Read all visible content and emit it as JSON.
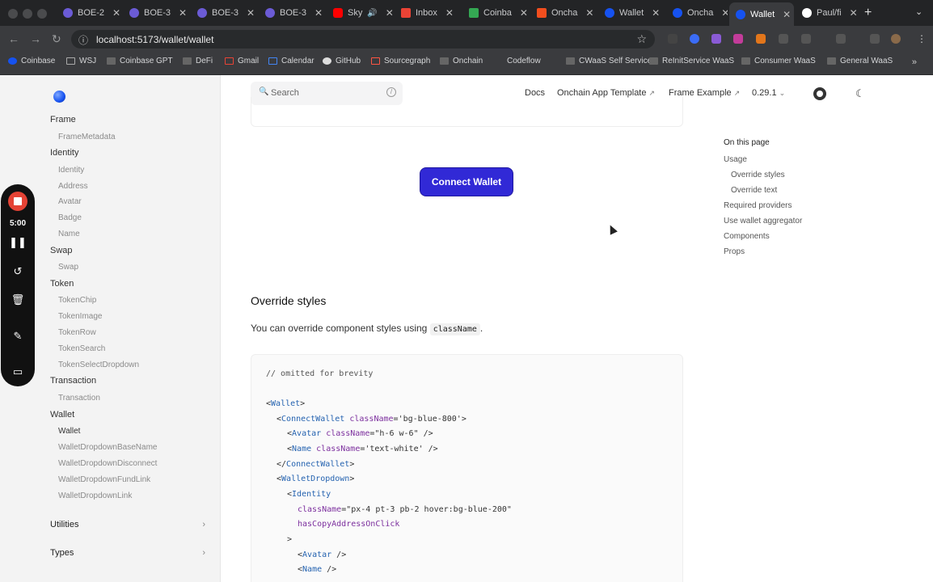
{
  "browser": {
    "tabs": [
      {
        "title": "BOE-2",
        "color": "#6b5bd6"
      },
      {
        "title": "BOE-3",
        "color": "#6b5bd6"
      },
      {
        "title": "BOE-3",
        "color": "#6b5bd6"
      },
      {
        "title": "BOE-3",
        "color": "#6b5bd6"
      },
      {
        "title": "Sky",
        "color": "#ff0000"
      },
      {
        "title": "Inbox",
        "color": "#ea4335"
      },
      {
        "title": "Coinba",
        "color": "#34a853"
      },
      {
        "title": "Oncha",
        "color": "#f24e1e"
      },
      {
        "title": "Wallet",
        "color": "#1652f0"
      },
      {
        "title": "Oncha",
        "color": "#1652f0"
      },
      {
        "title": "Wallet",
        "color": "#1652f0"
      },
      {
        "title": "Paul/fi",
        "color": "#ffffff"
      }
    ],
    "url": "localhost:5173/wallet/wallet",
    "bookmarks": [
      "Coinbase",
      "WSJ",
      "Coinbase GPT",
      "DeFi",
      "Gmail",
      "Calendar",
      "GitHub",
      "Sourcegraph",
      "Onchain",
      "Codeflow",
      "CWaaS Self Service",
      "ReInitService WaaS",
      "Consumer WaaS",
      "General WaaS"
    ]
  },
  "sidebar": {
    "groups": {
      "frame": "Frame",
      "identity": "Identity",
      "swap": "Swap",
      "token": "Token",
      "transaction": "Transaction",
      "wallet": "Wallet"
    },
    "items": {
      "frame_metadata": "FrameMetadata",
      "identity": "Identity",
      "address": "Address",
      "avatar": "Avatar",
      "badge": "Badge",
      "name": "Name",
      "swap": "Swap",
      "token_chip": "TokenChip",
      "token_image": "TokenImage",
      "token_row": "TokenRow",
      "token_search": "TokenSearch",
      "token_select_dropdown": "TokenSelectDropdown",
      "transaction": "Transaction",
      "wallet": "Wallet",
      "wallet_dropdown_basename": "WalletDropdownBaseName",
      "wallet_dropdown_disconnect": "WalletDropdownDisconnect",
      "wallet_dropdown_fund_link": "WalletDropdownFundLink",
      "wallet_dropdown_link": "WalletDropdownLink"
    },
    "collapsibles": {
      "utilities": "Utilities",
      "types": "Types"
    }
  },
  "recorder": {
    "time": "5:00"
  },
  "header": {
    "search_placeholder": "Search",
    "docs": "Docs",
    "onchain_template": "Onchain App Template",
    "frame_example": "Frame Example",
    "version": "0.29.1"
  },
  "main": {
    "connect_wallet": "Connect Wallet",
    "override_styles_heading": "Override styles",
    "override_paragraph": "You can override component styles using",
    "override_code": "className",
    "override_period": "."
  },
  "toc": {
    "title": "On this page",
    "usage": "Usage",
    "override_styles": "Override styles",
    "override_text": "Override text",
    "required_providers": "Required providers",
    "use_wallet_aggregator": "Use wallet aggregator",
    "components": "Components",
    "props": "Props"
  },
  "code": {
    "comment": "// omitted for brevity",
    "wallet_open": "Wallet",
    "connect_wallet": "ConnectWallet",
    "classname": "className",
    "bg_blue_800": "'bg-blue-800'",
    "avatar": "Avatar",
    "h6w6": "\"h-6 w-6\"",
    "name": "Name",
    "text_white": "'text-white'",
    "wallet_dropdown": "WalletDropdown",
    "identity": "Identity",
    "identity_classes": "\"px-4 pt-3 pb-2 hover:bg-blue-200\"",
    "has_copy": "hasCopyAddressOnClick"
  },
  "colors": {
    "connect_button": "#3129d6",
    "recorder_dot": "#e54335",
    "tag": "#2563b0",
    "attr": "#7c2f9e"
  }
}
